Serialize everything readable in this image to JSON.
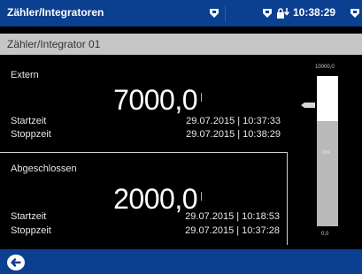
{
  "header": {
    "title": "Zähler/Integratoren",
    "time": "10:38:29"
  },
  "subheader": {
    "title": "Zähler/Integrator 01"
  },
  "panels": [
    {
      "label": "Extern",
      "value": "7000,0",
      "rows": [
        {
          "label": "Startzeit",
          "value": "29.07.2015 | 10:37:33"
        },
        {
          "label": "Stoppzeit",
          "value": "29.07.2015 | 10:38:29"
        }
      ]
    },
    {
      "label": "Abgeschlossen",
      "value": "2000,0",
      "rows": [
        {
          "label": "Startzeit",
          "value": "29.07.2015 | 10:18:53"
        },
        {
          "label": "Stoppzeit",
          "value": "29.07.2015 | 10:37:28"
        }
      ]
    }
  ],
  "gauge": {
    "max_label": "10000,0",
    "min_label": "0,0",
    "percent_label": "70%",
    "fill_fraction": 0.7
  },
  "icons": {
    "header_left": "shield-icon",
    "header_right_1": "shield-icon",
    "header_right_2": "download-lock-icon",
    "header_right_3": "shield-icon",
    "footer": "back-icon"
  },
  "colors": {
    "header_bg": "#0b3f8f",
    "subheader_bg": "#c6c6c6",
    "gauge_fill": "#b9b9b9"
  }
}
